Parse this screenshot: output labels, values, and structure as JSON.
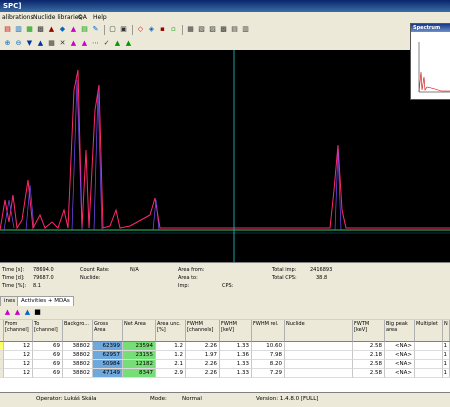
{
  "window": {
    "title": "SPC]"
  },
  "menu": {
    "items": [
      "alibrations",
      "Nuclide libraries",
      "QA",
      "Help"
    ]
  },
  "spectrum_window": {
    "title": "Spectrum"
  },
  "info": {
    "time_s": "Time [s]:",
    "time_s_val": "78694.0",
    "time_d": "Time [d]:",
    "time_d_val": "79687.0",
    "time_pct": "Time [%]:",
    "time_pct_val": "8.1",
    "count_rate": "Count Rate:",
    "count_rate_val": "N/A",
    "nuclide": "Nuclide:",
    "area_from": "Area from:",
    "area_to": "Area to:",
    "imp": "Imp:",
    "cps": "CPS:",
    "total_imp": "Total imp:",
    "total_imp_val": "2416893",
    "total_cps": "Total CPS:",
    "total_cps_val": "38.8"
  },
  "tabs": [
    "ines",
    "Activities + MDAs"
  ],
  "table": {
    "headers": [
      "From [channel]",
      "To [channel]",
      "Backgro...",
      "Gross Area",
      "Net Area",
      "Area unc. [%]",
      "FWHM [channels]",
      "FWHM [keV]",
      "FWHM rel.",
      "Nuclide",
      "FWTM [keV]",
      "Big peak area",
      "Multiplet",
      "N"
    ],
    "rows": [
      [
        "12",
        "69",
        "38802",
        "62399",
        "23594",
        "1.2",
        "2.26",
        "1.33",
        "10.60",
        "",
        "2.58",
        "<NA>",
        "",
        "1"
      ],
      [
        "12",
        "69",
        "38802",
        "62957",
        "23155",
        "1.2",
        "1.97",
        "1.36",
        "7.98",
        "",
        "2.18",
        "<NA>",
        "",
        "1"
      ],
      [
        "12",
        "69",
        "38802",
        "50984",
        "12182",
        "2.1",
        "2.26",
        "1.33",
        "8.20",
        "",
        "2.58",
        "<NA>",
        "",
        "1"
      ],
      [
        "12",
        "69",
        "38802",
        "47149",
        "8347",
        "2.9",
        "2.26",
        "1.33",
        "7.29",
        "",
        "2.58",
        "<NA>",
        "",
        "1"
      ]
    ]
  },
  "status": {
    "operator": "Operator: Lukáš Skála",
    "mode_label": "Mode:",
    "mode_val": "Normal",
    "version": "Version: 1.4.8.0 [FULL]"
  },
  "colors": {
    "gross": "#6fa8dc",
    "net": "#77dd77",
    "curve_main": "#ff2a6d",
    "curve_fit": "#7a4dff",
    "baseline": "#2ecc71",
    "cursor": "#1aa3a3"
  },
  "icons": {
    "toolbar1": [
      "open-icon",
      "save-icon",
      "print-icon",
      "spectrum-icon",
      "chart-icon",
      "nuclide-icon",
      "calibration-icon",
      "table-icon",
      "peak-icon",
      "copy-icon",
      "paste-icon",
      "export-icon",
      "import-icon",
      "settings-icon",
      "info-icon"
    ],
    "toolbar2": [
      "zoom-in-icon",
      "zoom-out-icon",
      "arrow-down-icon",
      "arrow-up-icon",
      "grid-icon",
      "fit-icon",
      "peak-mark-icon",
      "log-icon",
      "lin-icon",
      "area-icon",
      "graph-a-icon",
      "graph-b-icon"
    ]
  }
}
